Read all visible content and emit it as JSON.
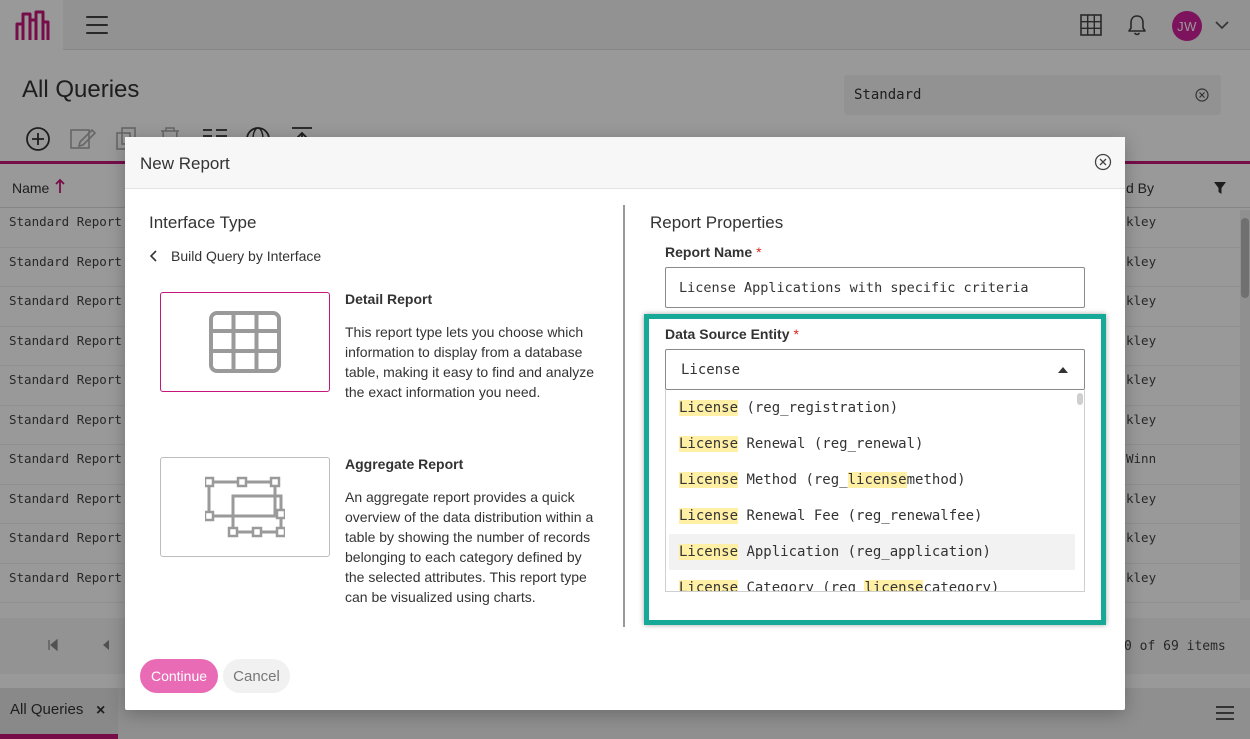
{
  "header": {
    "avatar_initials": "JW"
  },
  "page": {
    "title": "All Queries",
    "search_value": "Standard"
  },
  "grid": {
    "columns": {
      "name": "Name",
      "created_by_partial": "d By"
    },
    "rows": [
      {
        "name": "Standard Report -",
        "owner": "kley"
      },
      {
        "name": "Standard Report -",
        "owner": "kley"
      },
      {
        "name": "Standard Report -",
        "owner": "kley"
      },
      {
        "name": "Standard Report -",
        "owner": "kley"
      },
      {
        "name": "Standard Report -",
        "owner": "kley"
      },
      {
        "name": "Standard Report -",
        "owner": "kley"
      },
      {
        "name": "Standard Report -",
        "owner": "Winn"
      },
      {
        "name": "Standard Report -",
        "owner": "kley"
      },
      {
        "name": "Standard Report -",
        "owner": "kley"
      },
      {
        "name": "Standard Report -",
        "owner": "kley"
      }
    ],
    "pager_count": "0 of 69 items"
  },
  "bottom": {
    "tab_label": "All Queries",
    "tab_close": "×"
  },
  "modal": {
    "title": "New Report",
    "left": {
      "section_title": "Interface Type",
      "back_link": "Build Query by Interface",
      "types": [
        {
          "name": "Detail Report",
          "description": "This report type lets you choose which information to display from a database table, making it easy to find and analyze the exact information you need."
        },
        {
          "name": "Aggregate Report",
          "description": "An aggregate report provides a quick overview of the data distribution within a table by showing the number of records belonging to each category defined by the selected attributes. This report type can be visualized using charts."
        }
      ]
    },
    "right": {
      "section_title": "Report Properties",
      "report_name_label": "Report Name",
      "report_name_value": "License Applications with specific criteria",
      "entity_label": "Data Source Entity",
      "entity_value": "License",
      "required_mark": "*",
      "options": [
        {
          "match": "License",
          "rest": " (reg_registration)"
        },
        {
          "match": "License",
          "rest": " Renewal (reg_renewal)"
        },
        {
          "match": "License",
          "rest_pre": " Method (reg_",
          "match2": "license",
          "rest_post": "method)"
        },
        {
          "match": "License",
          "rest": " Renewal Fee (reg_renewalfee)"
        },
        {
          "match": "License",
          "rest": " Application (reg_application)"
        },
        {
          "match": "License",
          "rest_pre": " Category (reg_",
          "match2": "license",
          "rest_post": "category)"
        }
      ]
    },
    "buttons": {
      "continue": "Continue",
      "cancel": "Cancel"
    }
  },
  "colors": {
    "brand": "#c5177a",
    "highlight_frame": "#17a997",
    "match_highlight": "#fff0a6"
  }
}
